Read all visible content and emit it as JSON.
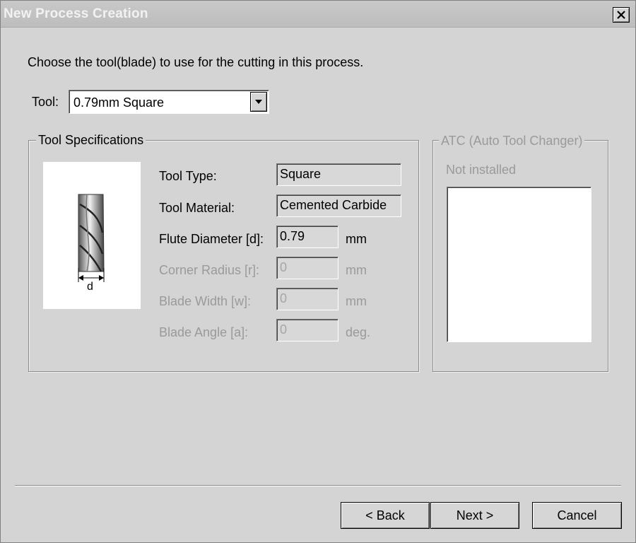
{
  "window": {
    "title": "New Process Creation"
  },
  "instruction": "Choose the tool(blade) to use for the cutting in this process.",
  "tool": {
    "label": "Tool:",
    "selected": "0.79mm Square"
  },
  "specs": {
    "legend": "Tool Specifications",
    "diagram_label": "d",
    "rows": [
      {
        "label": "Tool Type:",
        "value": "Square",
        "unit": "",
        "enabled": true
      },
      {
        "label": "Tool Material:",
        "value": "Cemented Carbide",
        "unit": "",
        "enabled": true
      },
      {
        "label": "Flute Diameter [d]:",
        "value": "0.79",
        "unit": "mm",
        "enabled": true
      },
      {
        "label": "Corner Radius [r]:",
        "value": "0",
        "unit": "mm",
        "enabled": false
      },
      {
        "label": "Blade Width [w]:",
        "value": "0",
        "unit": "mm",
        "enabled": false
      },
      {
        "label": "Blade Angle [a]:",
        "value": "0",
        "unit": "deg.",
        "enabled": false
      }
    ]
  },
  "atc": {
    "legend": "ATC (Auto Tool Changer)",
    "status": "Not installed"
  },
  "buttons": {
    "back": "< Back",
    "next": "Next >",
    "cancel": "Cancel"
  },
  "icons": {
    "close": "close-icon",
    "dropdown": "chevron-down-icon",
    "tool": "end-mill-icon"
  }
}
